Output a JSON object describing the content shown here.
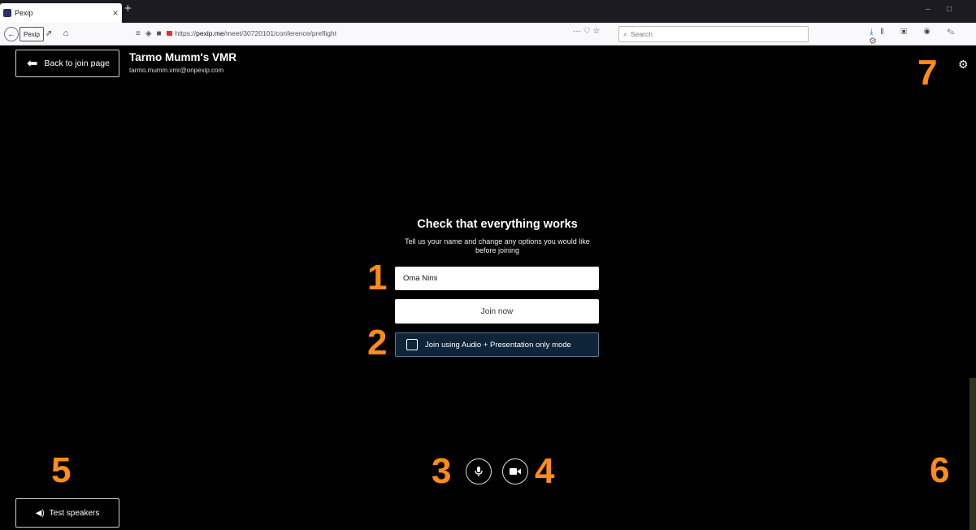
{
  "browser": {
    "tab_title": "Pexip",
    "tab_close": "×",
    "new_tab": "+",
    "win_min": "–",
    "win_max": "□",
    "back_btn": "←",
    "pexip_btn": "Pexip",
    "url_prefix": "https://",
    "url_host": "pexip.me",
    "url_path": "/meet/30720101/conference/preflight",
    "url_more": "···",
    "search_placeholder": "Search"
  },
  "app": {
    "back_label": "Back to join page",
    "vmr_name": "Tarmo Mumm's VMR",
    "vmr_email": "tarmo.mumm.vmr@onpexip.com",
    "heading": "Check that everything works",
    "subtext": "Tell us your name and change any options you would like before joining",
    "name_value": "Oma Nimi",
    "join_label": "Join now",
    "audio_mode_label": "Join using Audio + Presentation only mode",
    "speakers_label": "Test speakers"
  },
  "annotations": [
    "1",
    "2",
    "3",
    "4",
    "5",
    "6",
    "7"
  ],
  "colors": {
    "annotation": "#ff8c1a",
    "background": "#000000",
    "audio_option_bg": "#0e2438"
  }
}
